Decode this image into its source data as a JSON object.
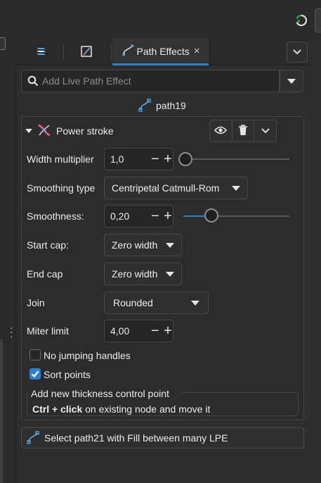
{
  "tabs": [
    {
      "icon": "layers-icon",
      "label": ""
    },
    {
      "icon": "fill-stroke-icon",
      "label": ""
    },
    {
      "icon": "path-effects-icon",
      "label": "Path Effects",
      "active": true
    }
  ],
  "tab_close": "×",
  "search": {
    "placeholder": "Add Live Path Effect"
  },
  "object_name": "path19",
  "effect": {
    "name": "Power stroke",
    "params": {
      "width_multiplier": {
        "label": "Width multiplier",
        "value": "1,0",
        "slider_fraction": 0.0
      },
      "smoothing_type": {
        "label": "Smoothing type",
        "value": "Centripetal Catmull-Rom"
      },
      "smoothness": {
        "label": "Smoothness:",
        "value": "0,20",
        "slider_fraction": 0.2
      },
      "start_cap": {
        "label": "Start cap:",
        "value": "Zero width"
      },
      "end_cap": {
        "label": "End cap",
        "value": "Zero width"
      },
      "join": {
        "label": "Join",
        "value": "Rounded"
      },
      "miter_limit": {
        "label": "Miter limit",
        "value": "4,00"
      }
    },
    "checks": {
      "no_jumping": {
        "label": "No jumping handles",
        "checked": false
      },
      "sort_points": {
        "label": "Sort points",
        "checked": true
      }
    },
    "help": {
      "title": "Add new thickness control point",
      "key1": "Ctrl",
      "plus": " + ",
      "key2": "click",
      "rest": " on existing node and move it"
    }
  },
  "spin": {
    "minus": "−",
    "plus": "+"
  },
  "bottom_action": "Select path21 with Fill between many LPE",
  "colors": {
    "accent": "#2d7fd0",
    "icon_blue": "#5aa9e6",
    "power_stroke_pink": "#e0557a"
  }
}
